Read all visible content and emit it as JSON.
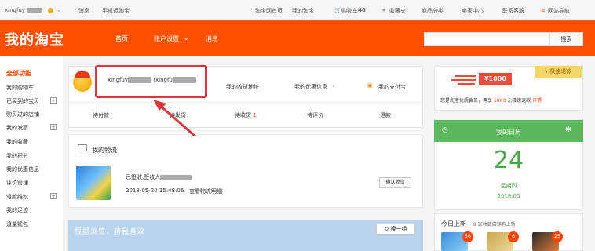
{
  "topbar": {
    "username": "xingfuy",
    "messages": "消息",
    "mobile": "手机逛淘宝",
    "home": "淘宝网首页",
    "my_taobao": "我的淘宝",
    "cart": "购物车",
    "cart_count": "40",
    "favorites": "收藏夹",
    "categories": "商品分类",
    "seller_center": "卖家中心",
    "contact": "联系客服",
    "site_nav": "网站导航"
  },
  "header": {
    "logo": "我的淘宝",
    "nav_home": "首页",
    "nav_account": "账户设置",
    "nav_messages": "消息",
    "search_button": "搜索",
    "search_placeholder": ""
  },
  "sidebar": {
    "head": "全部功能",
    "items": [
      "我的购物车",
      "已买到的宝贝",
      "购买过的店铺",
      "我的发票",
      "我的收藏",
      "我的积分",
      "我的优惠信息",
      "评价管理",
      "退款维权",
      "我的足迹",
      "流量钱包"
    ]
  },
  "profile": {
    "name": "xingfuy",
    "name_suffix": "(xingfu",
    "address_link": "我的收货地址",
    "discount_link": "我的优惠信息",
    "alipay_link": "我的支付宝"
  },
  "orders": {
    "to_pay": "待付款",
    "to_ship": "待发货",
    "to_receive": "待收货",
    "to_receive_count": "1",
    "to_review": "待评价",
    "refund": "退款"
  },
  "logistics": {
    "title": "我的物流",
    "status": "已签收,签收人",
    "time": "2018-05-20 15:48:06",
    "detail_link": "查看物流明细",
    "confirm_button": "确认收货"
  },
  "browse": {
    "title": "根据浏览，猜我喜欢",
    "swap_button": "换一组"
  },
  "coupon": {
    "amount": "¥1000",
    "badge": "极速退款",
    "text_prefix": "您是淘宝优质会员，尊享",
    "text_amount": "1000",
    "text_suffix": "元极速退款",
    "detail": "详情"
  },
  "calendar": {
    "title": "我的日历",
    "day": "24",
    "weekday": "星期四",
    "year_month": "2018.05"
  },
  "recommend": {
    "title": "今日上新",
    "subtitle": "8 家收藏店铺有上新",
    "badges": [
      "56",
      "6",
      "25"
    ]
  },
  "colors": {
    "brand": "#ff5000",
    "annotation_red": "#d9393e",
    "calendar_green": "#5cb85c"
  }
}
